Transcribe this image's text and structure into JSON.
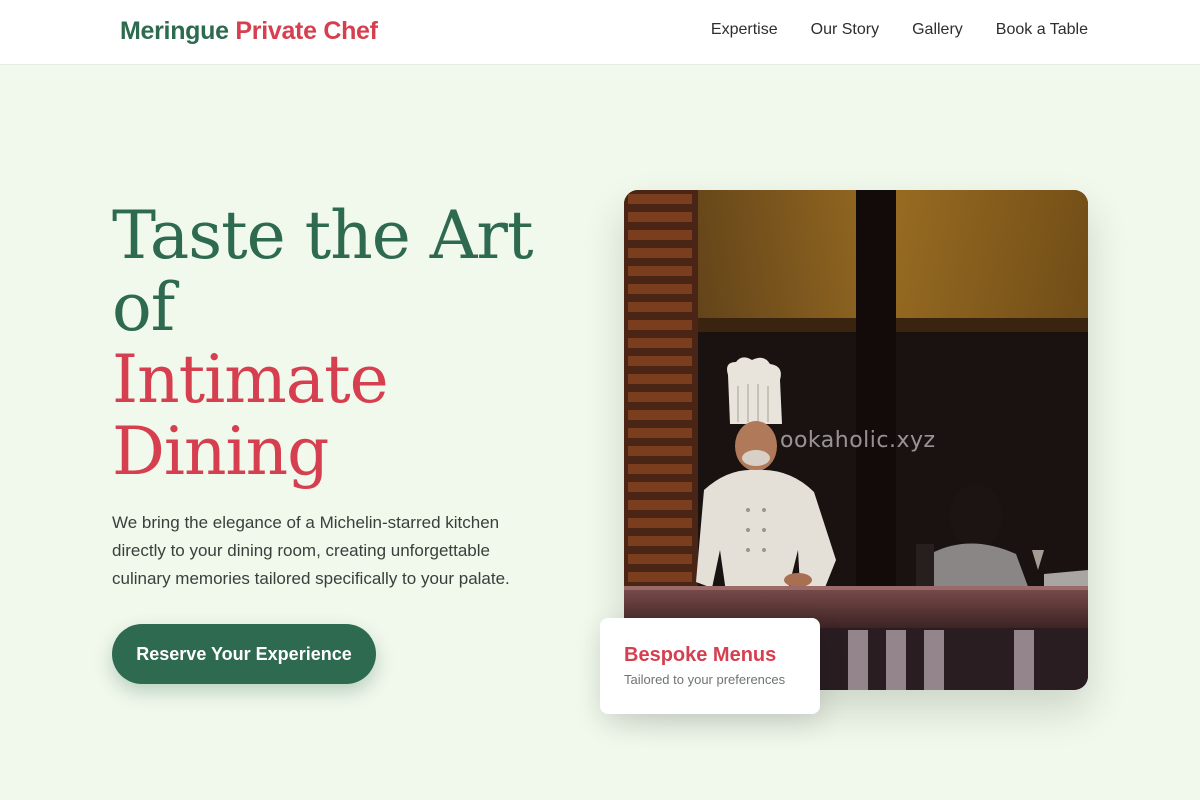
{
  "brand": {
    "name_part1": "Meringue",
    "name_part2": "Private Chef",
    "primary_color": "#2d6a4f",
    "accent_color": "#d63f4f",
    "background_color": "#f1f8ec"
  },
  "nav": {
    "items": [
      "Expertise",
      "Our Story",
      "Gallery",
      "Book a Table"
    ]
  },
  "hero": {
    "headline_line1": "Taste the Art",
    "headline_line2": "of",
    "headline_line3": "Intimate",
    "headline_line4": "Dining",
    "description": "We bring the elegance of a Michelin-starred kitchen directly to your dining room, creating unforgettable culinary memories tailored specifically to your palate.",
    "cta_label": "Reserve Your Experience",
    "watermark": "ookaholic.xyz"
  },
  "feature_card": {
    "title": "Bespoke Menus",
    "subtitle": "Tailored to your preferences"
  }
}
